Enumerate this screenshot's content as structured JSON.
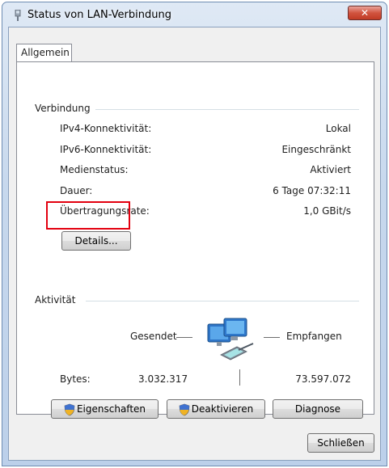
{
  "window": {
    "title": "Status von LAN-Verbindung",
    "close_label": "✕"
  },
  "tabs": [
    {
      "label": "Allgemein"
    }
  ],
  "connection": {
    "heading": "Verbindung",
    "rows": [
      {
        "label": "IPv4-Konnektivität:",
        "value": "Lokal"
      },
      {
        "label": "IPv6-Konnektivität:",
        "value": "Eingeschränkt"
      },
      {
        "label": "Medienstatus:",
        "value": "Aktiviert"
      },
      {
        "label": "Dauer:",
        "value": "6 Tage 07:32:11"
      },
      {
        "label": "Übertragungsrate:",
        "value": "1,0 GBit/s"
      }
    ],
    "details_button": "Details..."
  },
  "activity": {
    "heading": "Aktivität",
    "sent_label": "Gesendet",
    "received_label": "Empfangen",
    "bytes_label": "Bytes:",
    "bytes_sent": "3.032.317",
    "bytes_received": "73.597.072",
    "icon": "network-computers-icon"
  },
  "buttons": {
    "properties": "Eigenschaften",
    "deactivate": "Deaktivieren",
    "diagnose": "Diagnose",
    "close": "Schließen"
  },
  "colors": {
    "highlight": "#e3000f",
    "close_button": "#c8412c"
  }
}
